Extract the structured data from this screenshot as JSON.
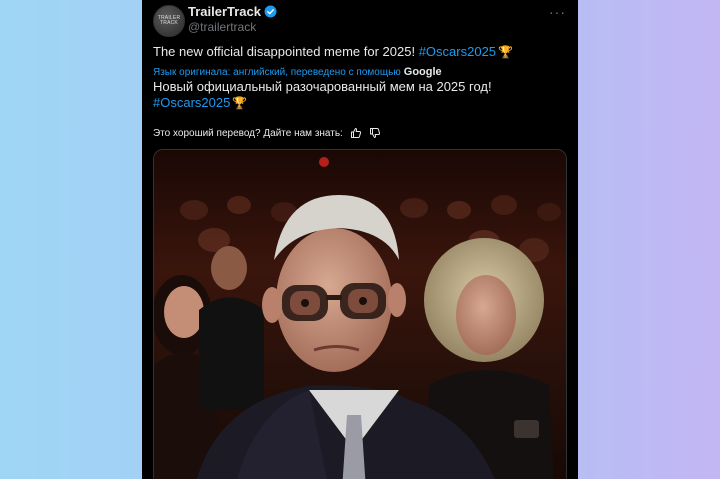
{
  "post": {
    "display_name": "TrailerTrack",
    "handle": "@trailertrack",
    "avatar_text": "TRAILER TRACK",
    "more_label": "···",
    "text": "The new official disappointed meme for 2025! ",
    "hashtag": "#Oscars2025",
    "trophy": "🏆",
    "translated_by_label": "Язык оригинала: английский, переведено с помощью",
    "translator_brand": "Google",
    "translated_text": "Новый официальный разочарованный мем на 2025 год!",
    "translated_hashtag": "#Oscars2025",
    "feedback_prompt": "Это хороший перевод? Дайте нам знать:"
  },
  "colors": {
    "accent": "#1d9bf0",
    "text": "#e7e9ea",
    "muted": "#71767b",
    "background": "#000000"
  },
  "icons": [
    "verified-badge-icon",
    "more-icon",
    "trophy-icon",
    "thumbs-up-icon",
    "thumbs-down-icon"
  ]
}
